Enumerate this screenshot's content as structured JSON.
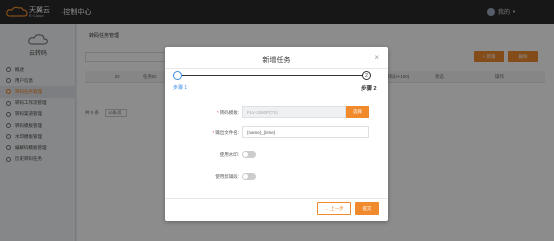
{
  "header": {
    "brand_cn": "天翼云",
    "brand_en": "E·Cloud",
    "console_title": "·控制中心",
    "username": "我的"
  },
  "sidebar": {
    "title": "云转码",
    "items": [
      {
        "label": "概述"
      },
      {
        "label": "用户信息"
      },
      {
        "label": "转码任务管理"
      },
      {
        "label": "转码工作流管理"
      },
      {
        "label": "转码渠道管理"
      },
      {
        "label": "转码模板管理"
      },
      {
        "label": "水印模板管理"
      },
      {
        "label": "编解码模板管理"
      },
      {
        "label": "历史转码任务"
      }
    ]
  },
  "main": {
    "page_title": "转码任务管理",
    "add_label": "+ 新增",
    "delete_label": "删除",
    "columns": [
      "ID",
      "任务ID",
      "转码(H-100)",
      "状态",
      "操作"
    ],
    "pager_total": "共 0 条",
    "pager_size": "10条/页"
  },
  "modal": {
    "title": "新增任务",
    "close": "×",
    "step1": "步骤 1",
    "step2_num": "2",
    "step2": "步骤 2",
    "template_label": "转码模板:",
    "template_value": "FLV-1080P(TS)",
    "select_button": "选择",
    "output_label": "输出文件名:",
    "output_value": "{name}_{time}",
    "watermark_label": "使用水印:",
    "clip_label": "使用剪辑段:",
    "prev_label": "← 上一步",
    "submit_label": "提交"
  },
  "colors": {
    "accent": "#f08a2c",
    "step_active": "#3a8ee6",
    "topbar": "#2b2b2b"
  }
}
